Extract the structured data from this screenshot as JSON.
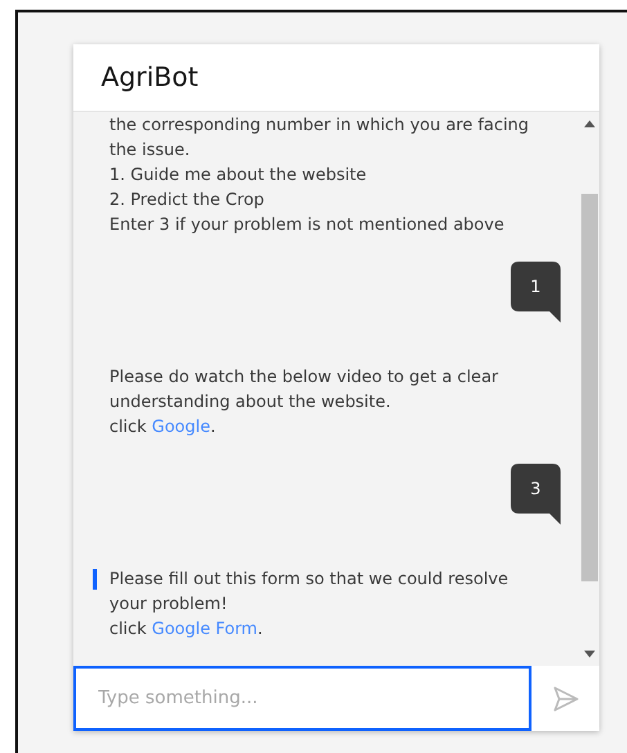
{
  "header": {
    "title": "AgriBot"
  },
  "messages": [
    {
      "kind": "bot",
      "focused": false,
      "lines": [
        "the corresponding number in which you are facing the issue.",
        "1. Guide me about the website",
        "2. Predict the Crop",
        "Enter 3 if your problem is not mentioned above"
      ]
    },
    {
      "kind": "user",
      "text": "1"
    },
    {
      "kind": "bot",
      "focused": false,
      "lines": [
        "Please do watch the below video to get a clear understanding about the website."
      ],
      "link_line": {
        "before": "click ",
        "link": "Google",
        "after": "."
      }
    },
    {
      "kind": "user",
      "text": "3"
    },
    {
      "kind": "bot",
      "focused": true,
      "lines": [
        "Please fill out this form so that we could resolve your problem!"
      ],
      "link_line": {
        "before": "click ",
        "link": "Google Form",
        "after": "."
      }
    }
  ],
  "input": {
    "placeholder": "Type something..."
  }
}
